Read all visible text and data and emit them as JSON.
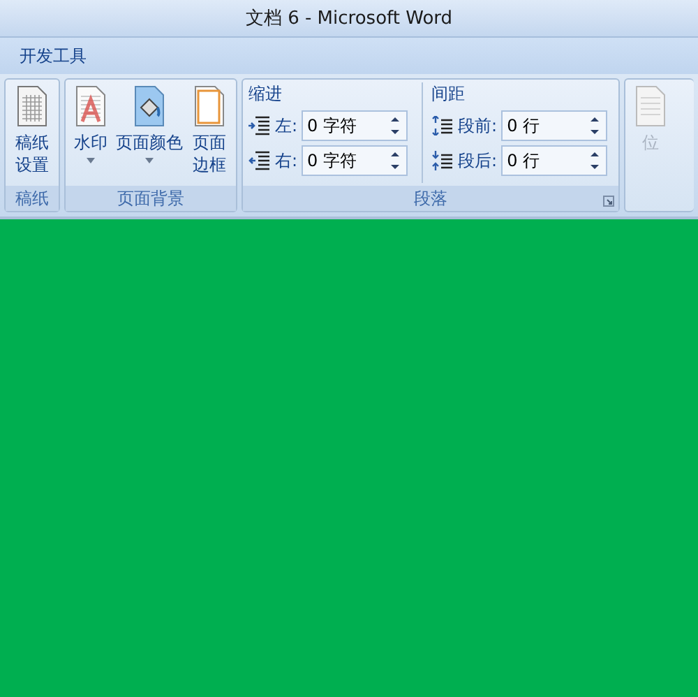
{
  "window": {
    "title": "文档 6 - Microsoft Word"
  },
  "ribbon_tab": "开发工具",
  "groups": [
    {
      "kind": "buttons",
      "label": "稿纸",
      "buttons": [
        {
          "label": "稿纸设置",
          "kind": "grid-paper",
          "dropdown": false
        }
      ]
    },
    {
      "kind": "buttons",
      "label": "页面背景",
      "buttons": [
        {
          "label": "水印",
          "kind": "watermark",
          "dropdown": true
        },
        {
          "label": "页面颜色",
          "kind": "paint-bucket",
          "dropdown": true
        },
        {
          "label": "页面边框",
          "kind": "page-border",
          "dropdown": false
        }
      ]
    },
    {
      "kind": "paragraph",
      "label": "段落",
      "sections": [
        {
          "heading": "缩进",
          "rows": [
            {
              "kind": "indent-left",
              "label": "左:",
              "value": "0 字符"
            },
            {
              "kind": "indent-right",
              "label": "右:",
              "value": "0 字符"
            }
          ]
        },
        {
          "heading": "间距",
          "rows": [
            {
              "kind": "space-before",
              "label": "段前:",
              "value": "0 行"
            },
            {
              "kind": "space-after",
              "label": "段后:",
              "value": "0 行"
            }
          ]
        }
      ]
    },
    {
      "kind": "partial",
      "buttons": [
        {
          "label": "位",
          "disabled": true
        }
      ]
    }
  ],
  "document": {
    "kind": "green"
  }
}
